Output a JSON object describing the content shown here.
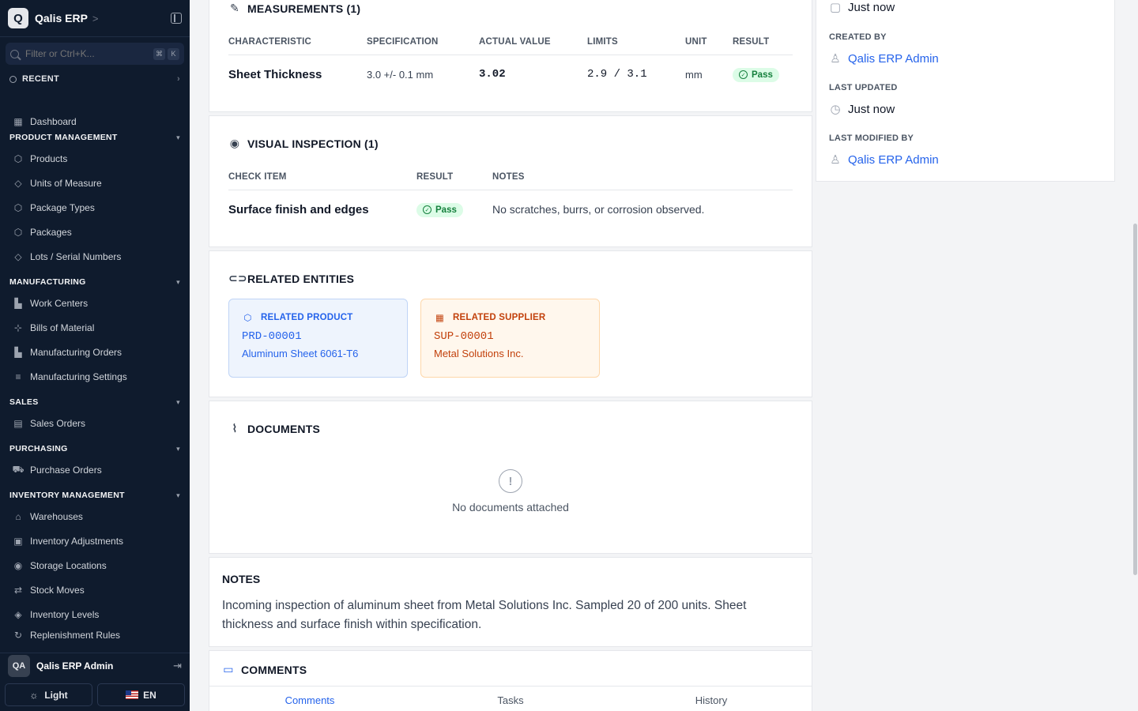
{
  "app": {
    "logo_letter": "Q",
    "name": "Qalis ERP"
  },
  "search": {
    "placeholder": "Filter or Ctrl+K...",
    "kbd1": "⌘",
    "kbd2": "K"
  },
  "recent": {
    "label": "RECENT"
  },
  "nav": {
    "dashboard": "Dashboard",
    "sections": {
      "product_management": "PRODUCT MANAGEMENT",
      "manufacturing": "MANUFACTURING",
      "sales": "SALES",
      "purchasing": "PURCHASING",
      "inventory_management": "INVENTORY MANAGEMENT"
    },
    "products": "Products",
    "units_of_measure": "Units of Measure",
    "package_types": "Package Types",
    "packages": "Packages",
    "lots_serial": "Lots / Serial Numbers",
    "work_centers": "Work Centers",
    "bills_of_material": "Bills of Material",
    "manufacturing_orders": "Manufacturing Orders",
    "manufacturing_settings": "Manufacturing Settings",
    "sales_orders": "Sales Orders",
    "purchase_orders": "Purchase Orders",
    "warehouses": "Warehouses",
    "inventory_adjustments": "Inventory Adjustments",
    "storage_locations": "Storage Locations",
    "stock_moves": "Stock Moves",
    "inventory_levels": "Inventory Levels",
    "replenishment_rules": "Replenishment Rules"
  },
  "user": {
    "initials": "QA",
    "name": "Qalis ERP Admin"
  },
  "footer": {
    "theme": "Light",
    "lang": "EN"
  },
  "measurements": {
    "title": "MEASUREMENTS (1)",
    "headers": [
      "CHARACTERISTIC",
      "SPECIFICATION",
      "ACTUAL VALUE",
      "LIMITS",
      "UNIT",
      "RESULT"
    ],
    "row": {
      "characteristic": "Sheet Thickness",
      "spec": "3.0 +/- 0.1 mm",
      "actual": "3.02",
      "limits": "2.9 / 3.1",
      "unit": "mm",
      "result": "Pass"
    }
  },
  "visual": {
    "title": "VISUAL INSPECTION (1)",
    "headers": [
      "CHECK ITEM",
      "RESULT",
      "NOTES"
    ],
    "row": {
      "item": "Surface finish and edges",
      "result": "Pass",
      "notes": "No scratches, burrs, or corrosion observed."
    }
  },
  "related": {
    "title": "RELATED ENTITIES",
    "product": {
      "label": "RELATED PRODUCT",
      "code": "PRD-00001",
      "name": "Aluminum Sheet 6061-T6",
      "color": "#2563eb",
      "bg": "#eef4fd"
    },
    "supplier": {
      "label": "RELATED SUPPLIER",
      "code": "SUP-00001",
      "name": "Metal Solutions Inc.",
      "color": "#c2410c",
      "bg": "#fff7ed"
    }
  },
  "documents": {
    "title": "DOCUMENTS",
    "empty": "No documents attached"
  },
  "notes": {
    "title": "NOTES",
    "text": "Incoming inspection of aluminum sheet from Metal Solutions Inc. Sampled 20 of 200 units. Sheet thickness and surface finish within specification."
  },
  "comments": {
    "title": "COMMENTS",
    "tabs": [
      "Comments",
      "Tasks",
      "History"
    ]
  },
  "meta": {
    "created_at": "Just now",
    "created_by_label": "CREATED BY",
    "created_by": "Qalis ERP Admin",
    "last_updated_label": "LAST UPDATED",
    "last_updated": "Just now",
    "last_modified_by_label": "LAST MODIFIED BY",
    "last_modified_by": "Qalis ERP Admin"
  }
}
